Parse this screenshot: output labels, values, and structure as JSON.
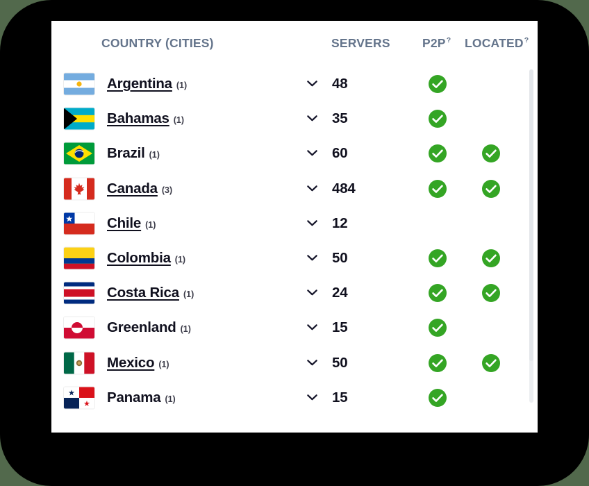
{
  "background_color": "#52694c",
  "frame_color": "#000000",
  "card_color": "#ffffff",
  "header": {
    "country": "COUNTRY (CITIES)",
    "servers": "SERVERS",
    "p2p": "P2P",
    "located": "LOCATED",
    "help_marker": "?",
    "color": "#64748b"
  },
  "accent": {
    "check_green": "#34a524",
    "link_color": "#10101e",
    "count_color": "#3b3b48"
  },
  "rows": [
    {
      "country": "Argentina",
      "cities": "(1)",
      "servers": "48",
      "p2p": true,
      "located": false,
      "is_link": true,
      "flag": "argentina-flag"
    },
    {
      "country": "Bahamas",
      "cities": "(1)",
      "servers": "35",
      "p2p": true,
      "located": false,
      "is_link": true,
      "flag": "bahamas-flag"
    },
    {
      "country": "Brazil",
      "cities": "(1)",
      "servers": "60",
      "p2p": true,
      "located": true,
      "is_link": false,
      "flag": "brazil-flag"
    },
    {
      "country": "Canada",
      "cities": "(3)",
      "servers": "484",
      "p2p": true,
      "located": true,
      "is_link": true,
      "flag": "canada-flag"
    },
    {
      "country": "Chile",
      "cities": "(1)",
      "servers": "12",
      "p2p": false,
      "located": false,
      "is_link": true,
      "flag": "chile-flag"
    },
    {
      "country": "Colombia",
      "cities": "(1)",
      "servers": "50",
      "p2p": true,
      "located": true,
      "is_link": true,
      "flag": "colombia-flag"
    },
    {
      "country": "Costa Rica",
      "cities": "(1)",
      "servers": "24",
      "p2p": true,
      "located": true,
      "is_link": true,
      "flag": "costa-rica-flag"
    },
    {
      "country": "Greenland",
      "cities": "(1)",
      "servers": "15",
      "p2p": true,
      "located": false,
      "is_link": false,
      "flag": "greenland-flag"
    },
    {
      "country": "Mexico",
      "cities": "(1)",
      "servers": "50",
      "p2p": true,
      "located": true,
      "is_link": true,
      "flag": "mexico-flag"
    },
    {
      "country": "Panama",
      "cities": "(1)",
      "servers": "15",
      "p2p": true,
      "located": false,
      "is_link": false,
      "flag": "panama-flag"
    }
  ],
  "icons": {
    "expand": "chevron-down-icon",
    "yes": "green-check-circle-icon"
  }
}
